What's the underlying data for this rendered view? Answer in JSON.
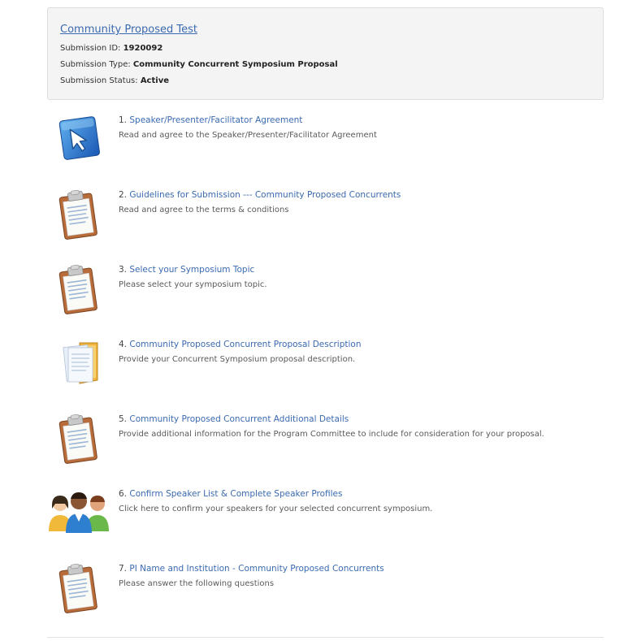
{
  "submission": {
    "title": "Community Proposed Test",
    "id_label": "Submission ID:",
    "id_value": "1920092",
    "type_label": "Submission Type:",
    "type_value": "Community Concurrent Symposium Proposal",
    "status_label": "Submission Status:",
    "status_value": "Active"
  },
  "steps": [
    {
      "num": "1.",
      "title": "Speaker/Presenter/Facilitator Agreement",
      "desc": "Read and agree to the Speaker/Presenter/Facilitator Agreement",
      "icon": "cursor-icon"
    },
    {
      "num": "2.",
      "title": "Guidelines for Submission --- Community Proposed Concurrents",
      "desc": "Read and agree to the terms & conditions",
      "icon": "clipboard-icon"
    },
    {
      "num": "3.",
      "title": "Select your Symposium Topic",
      "desc": "Please select your symposium topic.",
      "icon": "clipboard-icon"
    },
    {
      "num": "4.",
      "title": "Community Proposed Concurrent Proposal Description",
      "desc": "Provide your Concurrent Symposium proposal description.",
      "icon": "folder-documents-icon"
    },
    {
      "num": "5.",
      "title": "Community Proposed Concurrent Additional Details",
      "desc": "Provide additional information for the Program Committee to include for consideration for your proposal.",
      "icon": "clipboard-icon"
    },
    {
      "num": "6.",
      "title": "Confirm Speaker List & Complete Speaker Profiles",
      "desc": "Click here to confirm your speakers for your selected concurrent symposium.",
      "icon": "people-group-icon"
    },
    {
      "num": "7.",
      "title": "PI Name and Institution - Community Proposed Concurrents",
      "desc": "Please answer the following questions",
      "icon": "clipboard-icon"
    }
  ],
  "colors": {
    "link": "#3a6ab0",
    "panel_bg": "#f4f4f4"
  }
}
